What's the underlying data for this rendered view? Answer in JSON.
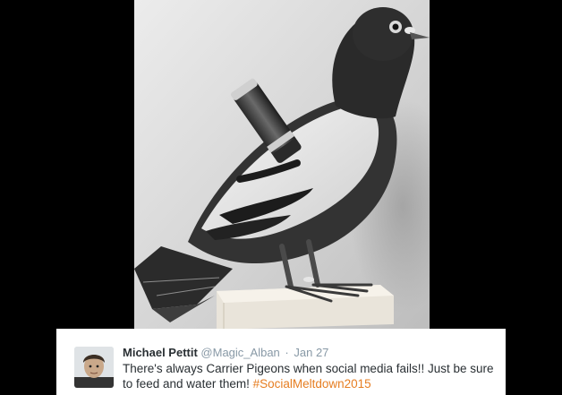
{
  "tweet": {
    "author_name": "Michael Pettit",
    "author_handle": "@Magic_Alban",
    "separator": "·",
    "date": "Jan 27",
    "text": "There's always Carrier Pigeons when social media fails!! Just be sure to feed and water them! ",
    "hashtag": "#SocialMeltdown2015"
  },
  "colors": {
    "background": "#000000",
    "card": "#ffffff",
    "name": "#292f33",
    "muted": "#8899a6",
    "hashtag": "#e67e22"
  },
  "photo": {
    "subject": "carrier-pigeon-with-message-canister"
  }
}
